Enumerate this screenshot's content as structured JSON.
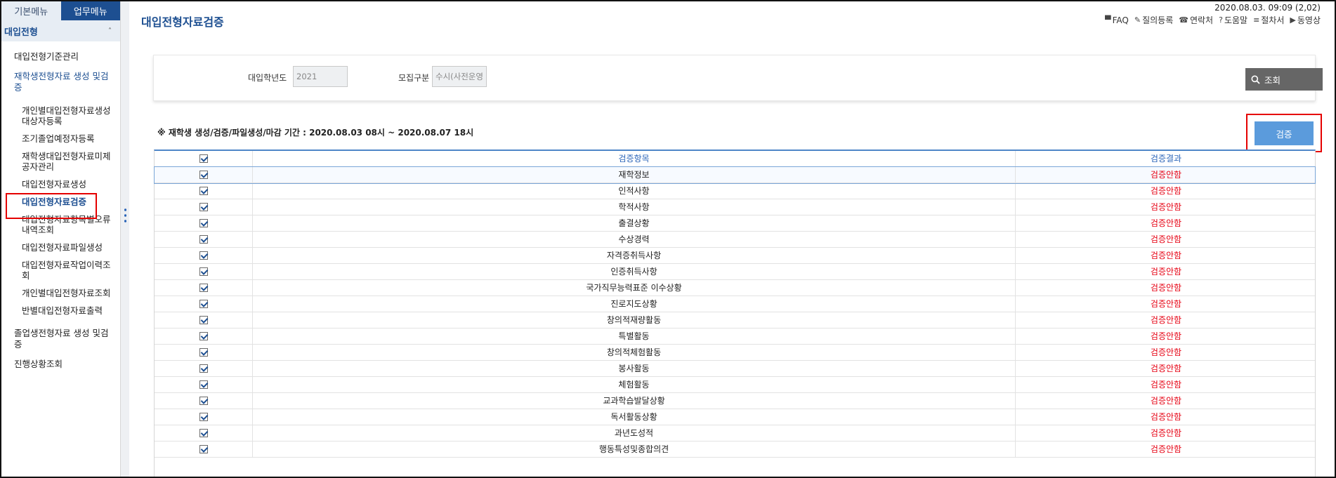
{
  "sidebar": {
    "tabs": [
      "기본메뉴",
      "업무메뉴"
    ],
    "section": "대입전형",
    "section_caret": "˄",
    "items": {
      "criteria": "대입전형기준관리",
      "enrolled": "재학생전형자료 생성 및검증",
      "graduate": "졸업생전형자료 생성 및검증",
      "progress": "진행상황조회"
    },
    "subitems": [
      "개인별대입전형자료생성대상자등록",
      "조기졸업예정자등록",
      "재학생대입전형자료미제공자관리",
      "대입전형자료생성",
      "대입전형자료검증",
      "대입전형자료항목별오류내역조회",
      "대입전형자료파일생성",
      "대입전형자료작업이력조회",
      "개인별대입전형자료조회",
      "반별대입전형자료출력"
    ]
  },
  "header": {
    "title": "대입전형자료검증",
    "datetime": "2020.08.03. 09:09 (2,02)",
    "links": [
      {
        "icon": "faq-icon",
        "label": "FAQ"
      },
      {
        "icon": "pencil-icon",
        "label": "질의등록"
      },
      {
        "icon": "phone-icon",
        "label": "연락처"
      },
      {
        "icon": "help-icon",
        "label": "도움말"
      },
      {
        "icon": "list-icon",
        "label": "절차서"
      },
      {
        "icon": "play-icon",
        "label": "동영상"
      }
    ]
  },
  "search": {
    "year_label": "대입학년도",
    "year_value": "2021",
    "type_label": "모집구분",
    "type_value": "수시(사전운영",
    "button_label": "조회"
  },
  "period_text": "※ 재학생 생성/검증/파일생성/마감 기간 :   2020.08.03  08시 ~ 2020.08.07  18시",
  "verify_button": "검증",
  "grid": {
    "headers": [
      "검증항목",
      "검증결과"
    ],
    "rows": [
      {
        "item": "재학정보",
        "result": "검증안함"
      },
      {
        "item": "인적사항",
        "result": "검증안함"
      },
      {
        "item": "학적사항",
        "result": "검증안함"
      },
      {
        "item": "출결상황",
        "result": "검증안함"
      },
      {
        "item": "수상경력",
        "result": "검증안함"
      },
      {
        "item": "자격증취득사항",
        "result": "검증안함"
      },
      {
        "item": "인증취득사항",
        "result": "검증안함"
      },
      {
        "item": "국가직무능력표준 이수상황",
        "result": "검증안함"
      },
      {
        "item": "진로지도상황",
        "result": "검증안함"
      },
      {
        "item": "창의적재량활동",
        "result": "검증안함"
      },
      {
        "item": "특별활동",
        "result": "검증안함"
      },
      {
        "item": "창의적체험활동",
        "result": "검증안함"
      },
      {
        "item": "봉사활동",
        "result": "검증안함"
      },
      {
        "item": "체험활동",
        "result": "검증안함"
      },
      {
        "item": "교과학습발달상황",
        "result": "검증안함"
      },
      {
        "item": "독서활동상황",
        "result": "검증안함"
      },
      {
        "item": "과년도성적",
        "result": "검증안함"
      },
      {
        "item": "행동특성및종합의견",
        "result": "검증안함"
      }
    ]
  },
  "colors": {
    "brand": "#1d4f91",
    "result_text": "#e60012",
    "highlight_box": "#e50000",
    "verify_button": "#5b9bdc"
  }
}
